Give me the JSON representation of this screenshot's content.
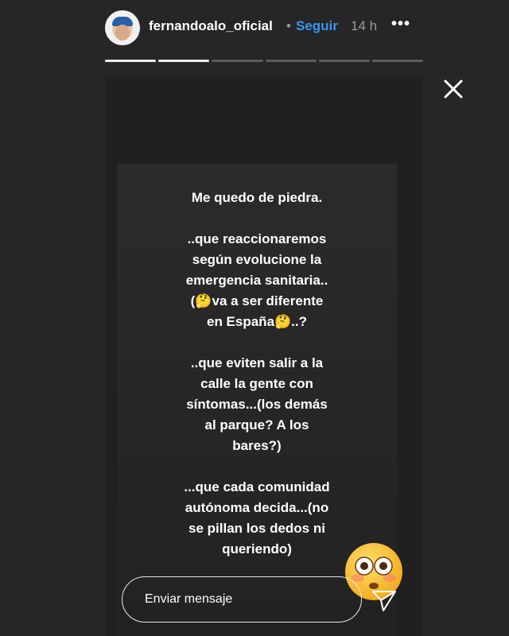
{
  "header": {
    "username": "fernandoalo_oficial",
    "separator": "•",
    "follow_label": "Seguir",
    "time": "14 h",
    "more_label": "•••"
  },
  "progress": {
    "total_segments": 6,
    "completed_segments": 2
  },
  "story": {
    "text": "Me quedo de piedra.\n\n..que reaccionaremos\nsegún evolucione la\nemergencia sanitaria..\n(🤔va a ser diferente\nen España🤔..?\n\n..que eviten salir a la\ncalle la gente con\nsíntomas...(los demás\nal parque? A los\nbares?)\n\n...que cada comunidad\nautónoma decida...(no\nse pillan los dedos ni\nqueriendo)"
  },
  "message_input": {
    "placeholder": "Enviar mensaje"
  },
  "icons": {
    "close": "close-icon",
    "send": "send-icon",
    "more": "more-options-icon",
    "emoji": "flushed-face-emoji"
  },
  "colors": {
    "follow": "#3897f0",
    "background": "#262626"
  }
}
